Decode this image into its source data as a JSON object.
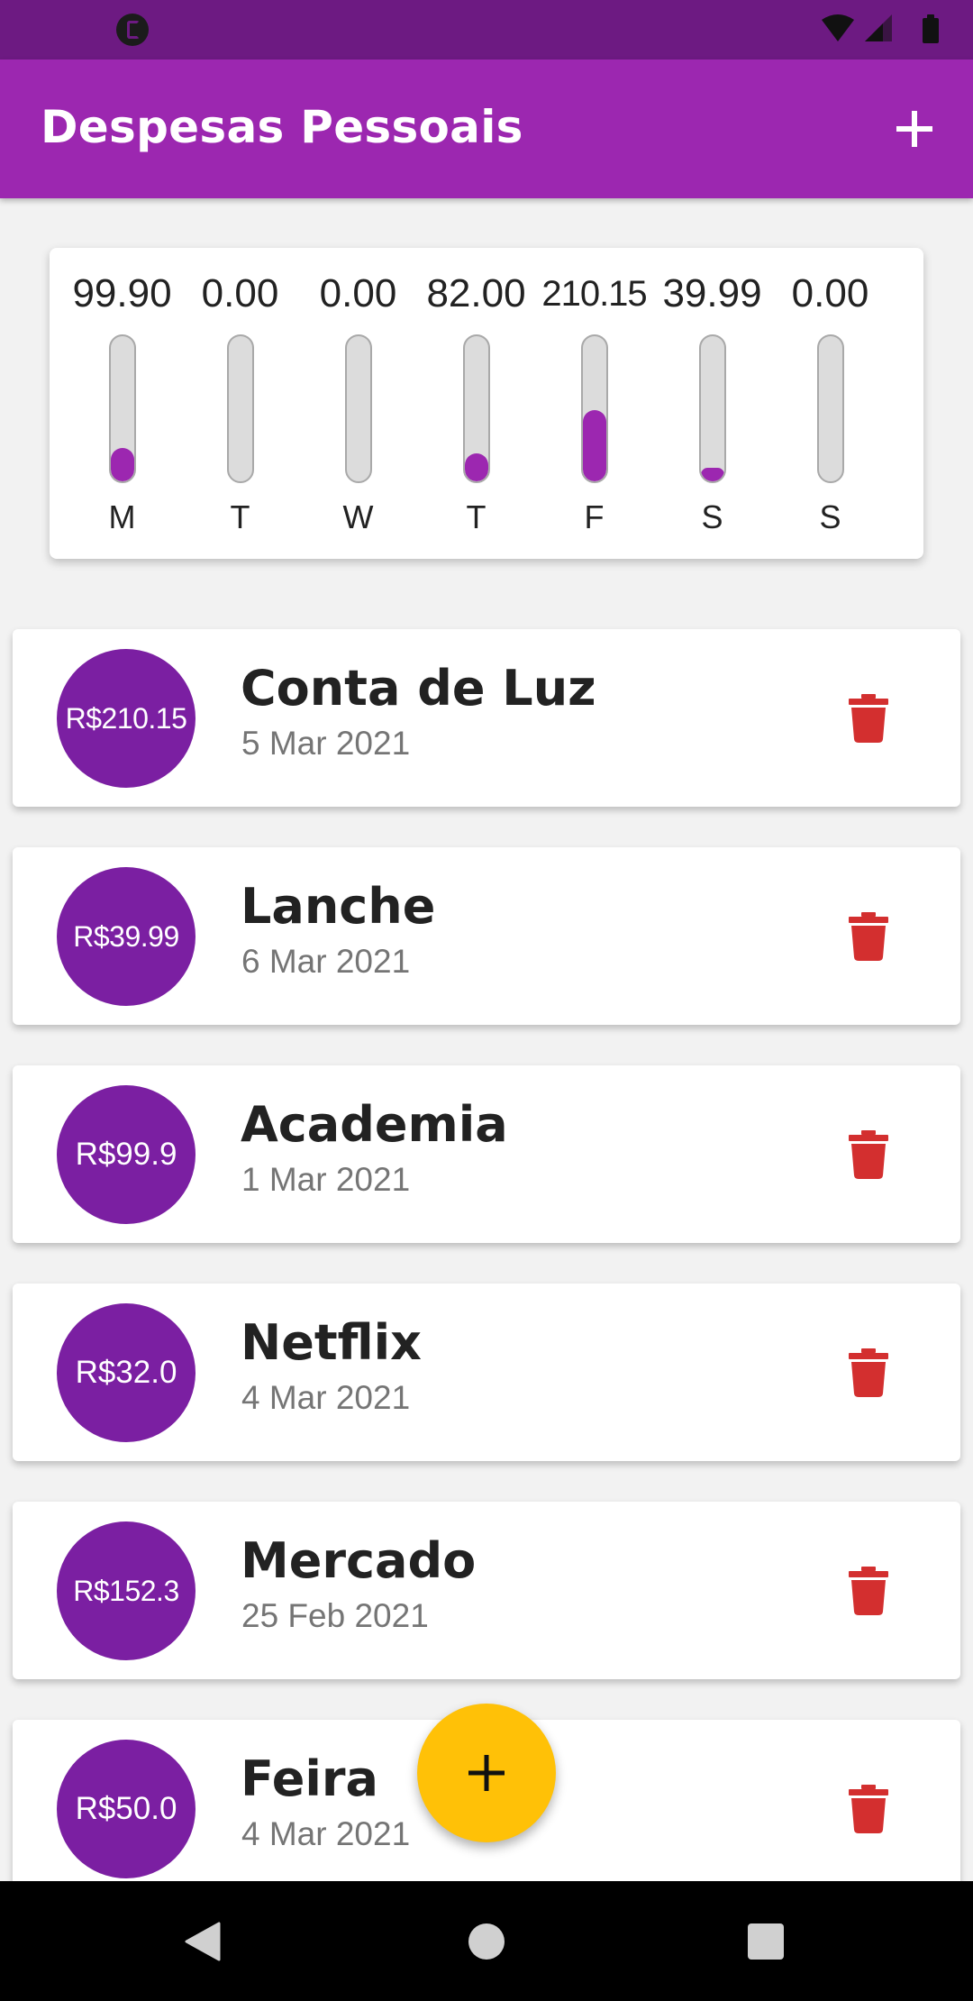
{
  "app_bar": {
    "title": "Despesas Pessoais",
    "add_icon": "plus-icon"
  },
  "chart_data": {
    "type": "bar",
    "categories": [
      "M",
      "T",
      "W",
      "T",
      "F",
      "S",
      "S"
    ],
    "labels": [
      "99.90",
      "0.00",
      "0.00",
      "82.00",
      "210.15",
      "39.99",
      "0.00"
    ],
    "values": [
      99.9,
      0.0,
      0.0,
      82.0,
      210.15,
      39.99,
      0.0
    ],
    "fill_fraction": [
      0.2323,
      0,
      0,
      0.1907,
      0.4887,
      0.093,
      0
    ]
  },
  "expenses": [
    {
      "amount": "R$210.15",
      "title": "Conta de Luz",
      "date": "5 Mar 2021"
    },
    {
      "amount": "R$39.99",
      "title": "Lanche",
      "date": "6 Mar 2021"
    },
    {
      "amount": "R$99.9",
      "title": "Academia",
      "date": "1 Mar 2021"
    },
    {
      "amount": "R$32.0",
      "title": "Netflix",
      "date": "4 Mar 2021"
    },
    {
      "amount": "R$152.3",
      "title": "Mercado",
      "date": "25 Feb 2021"
    },
    {
      "amount": "R$50.0",
      "title": "Feira",
      "date": "4 Mar 2021"
    }
  ],
  "fab": {
    "icon": "plus-icon"
  },
  "colors": {
    "primary": "#9c27b0",
    "primary_dark": "#6d1a82",
    "avatar": "#7b1fa2",
    "delete": "#d32f2f",
    "fab": "#ffc107"
  },
  "icons": {
    "delete": "trash-icon",
    "nav_back": "back-triangle-icon",
    "nav_home": "home-circle-icon",
    "nav_recents": "recents-square-icon"
  }
}
